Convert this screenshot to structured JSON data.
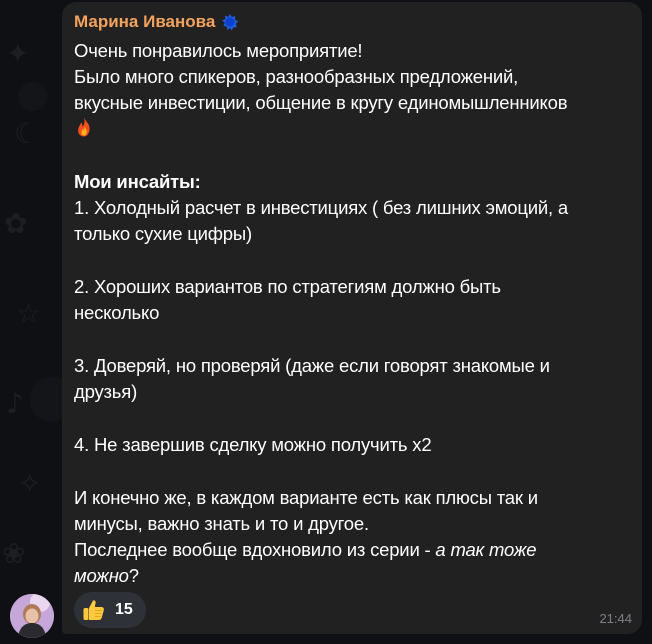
{
  "message": {
    "sender": "Марина Иванова",
    "lines": [
      "Очень понравилось мероприятие!",
      "Было много спикеров, разнообразных предложений,",
      "вкусные инвестиции, общение в кругу единомышленников",
      "",
      "Мои инсайты:",
      "1. Холодный расчет в инвестициях ( без лишних эмоций, а",
      "только сухие цифры)",
      "2. Хороших вариантов по стратегиям  должно быть",
      "несколько",
      "3. Доверяй, но проверяй (даже если говорят знакомые и",
      "друзья)",
      "4. Не завершив сделку можно получить х2",
      "И конечно же, в каждом варианте есть как плюсы так и",
      "минусы, важно знать и то и другое.",
      "Последнее вообще вдохновило из серии - ",
      "а так тоже",
      "можно",
      "?"
    ],
    "time": "21:44"
  },
  "reaction": {
    "emoji": "thumbs-up-icon",
    "count": "15"
  },
  "icons": {
    "sender_badge": "premium-star-icon",
    "line_emoji": "fire-icon"
  },
  "colors": {
    "sender_name": "#f5a25d",
    "bubble": "#212121",
    "background": "#0e1013",
    "badge": "#1f5fe0"
  }
}
